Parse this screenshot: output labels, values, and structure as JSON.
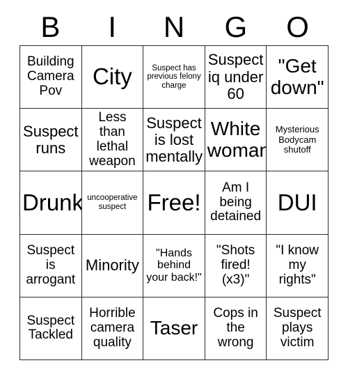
{
  "header": {
    "letters": [
      "B",
      "I",
      "N",
      "G",
      "O"
    ]
  },
  "grid": {
    "rows": 5,
    "columns": 5,
    "free_space_index": 12,
    "border_color": "#2b2b2b",
    "background_color": "#ffffff",
    "text_color": "#000000",
    "cells": [
      {
        "text": "Building Camera Pov",
        "size": "md"
      },
      {
        "text": "City",
        "size": "xxl"
      },
      {
        "text": "Suspect has previous felony charge",
        "size": "xxs"
      },
      {
        "text": "Suspect iq under 60",
        "size": "lg"
      },
      {
        "text": "\"Get down\"",
        "size": "xl"
      },
      {
        "text": "Suspect runs",
        "size": "lg"
      },
      {
        "text": "Less than lethal weapon",
        "size": "md"
      },
      {
        "text": "Suspect is lost mentally",
        "size": "lg"
      },
      {
        "text": "White woman",
        "size": "xl"
      },
      {
        "text": "Mysterious Bodycam shutoff",
        "size": "xs"
      },
      {
        "text": "Drunk",
        "size": "xxl"
      },
      {
        "text": "uncooperative suspect",
        "size": "xxs"
      },
      {
        "text": "Free!",
        "size": "xxl"
      },
      {
        "text": "Am I being detained",
        "size": "md"
      },
      {
        "text": "DUI",
        "size": "xxl"
      },
      {
        "text": "Suspect is arrogant",
        "size": "md"
      },
      {
        "text": "Minority",
        "size": "lg"
      },
      {
        "text": "\"Hands behind your back!\"",
        "size": "sm"
      },
      {
        "text": "\"Shots fired! (x3)\"",
        "size": "md"
      },
      {
        "text": "\"I know my rights\"",
        "size": "md"
      },
      {
        "text": "Suspect Tackled",
        "size": "md"
      },
      {
        "text": "Horrible camera quality",
        "size": "md"
      },
      {
        "text": "Taser",
        "size": "xl"
      },
      {
        "text": "Cops in the wrong",
        "size": "md"
      },
      {
        "text": "Suspect plays victim",
        "size": "md"
      }
    ]
  }
}
